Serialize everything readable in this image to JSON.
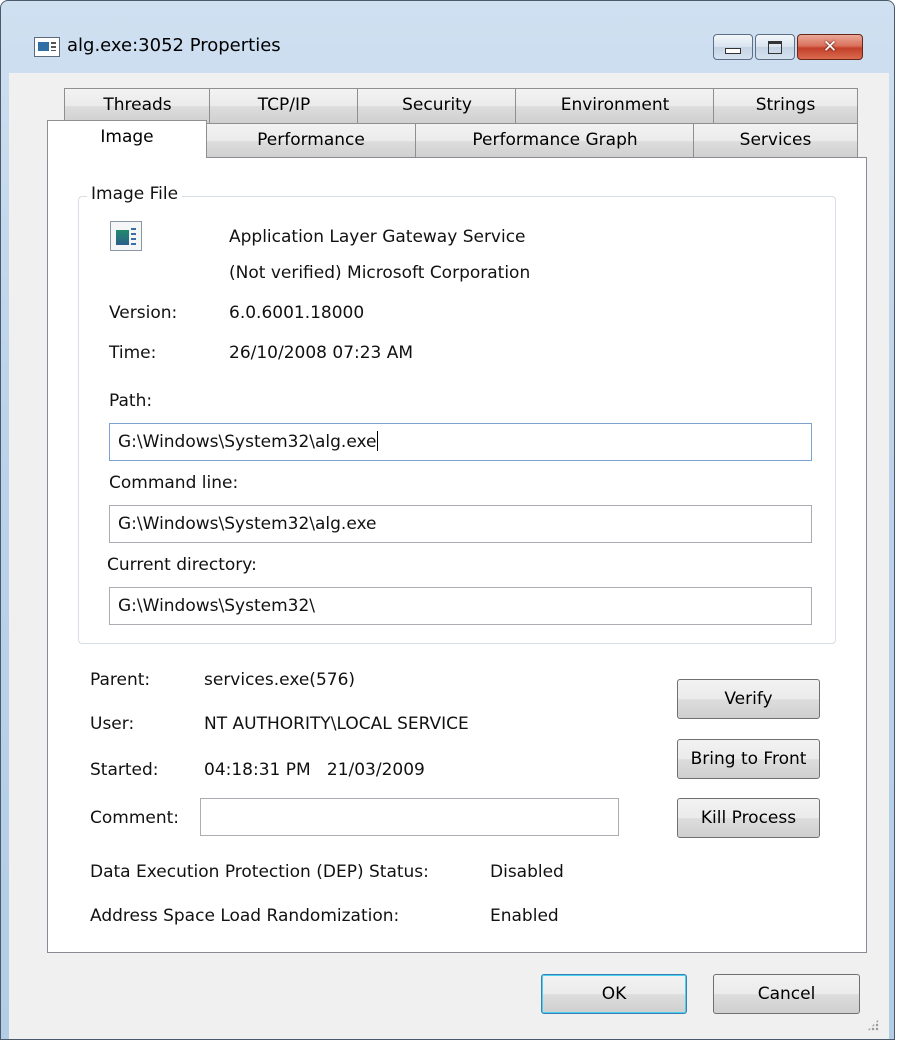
{
  "window": {
    "title": "alg.exe:3052 Properties",
    "controls": {
      "minimize": "minimize",
      "maximize": "maximize",
      "close": "close"
    }
  },
  "tabs": {
    "row1": [
      "Threads",
      "TCP/IP",
      "Security",
      "Environment",
      "Strings"
    ],
    "row2": [
      "Image",
      "Performance",
      "Performance Graph",
      "Services"
    ],
    "active": "Image"
  },
  "image_file": {
    "group_title": "Image File",
    "description": "Application Layer Gateway Service",
    "company": "(Not verified) Microsoft Corporation",
    "version_label": "Version:",
    "version_value": "6.0.6001.18000",
    "time_label": "Time:",
    "time_value": "26/10/2008 07:23 AM",
    "path_label": "Path:",
    "path_value": "G:\\Windows\\System32\\alg.exe",
    "cmdline_label": "Command line:",
    "cmdline_value": "G:\\Windows\\System32\\alg.exe",
    "curdir_label": "Current directory:",
    "curdir_value": "G:\\Windows\\System32\\"
  },
  "process": {
    "parent_label": "Parent:",
    "parent_value": "services.exe(576)",
    "user_label": "User:",
    "user_value": "NT AUTHORITY\\LOCAL SERVICE",
    "started_label": "Started:",
    "started_value": "04:18:31 PM   21/03/2009",
    "comment_label": "Comment:",
    "comment_value": "",
    "dep_label": "Data Execution Protection (DEP) Status:",
    "dep_value": "Disabled",
    "aslr_label": "Address Space Load Randomization:",
    "aslr_value": "Enabled"
  },
  "buttons": {
    "verify": "Verify",
    "bring_to_front": "Bring to Front",
    "kill_process": "Kill Process",
    "ok": "OK",
    "cancel": "Cancel"
  }
}
